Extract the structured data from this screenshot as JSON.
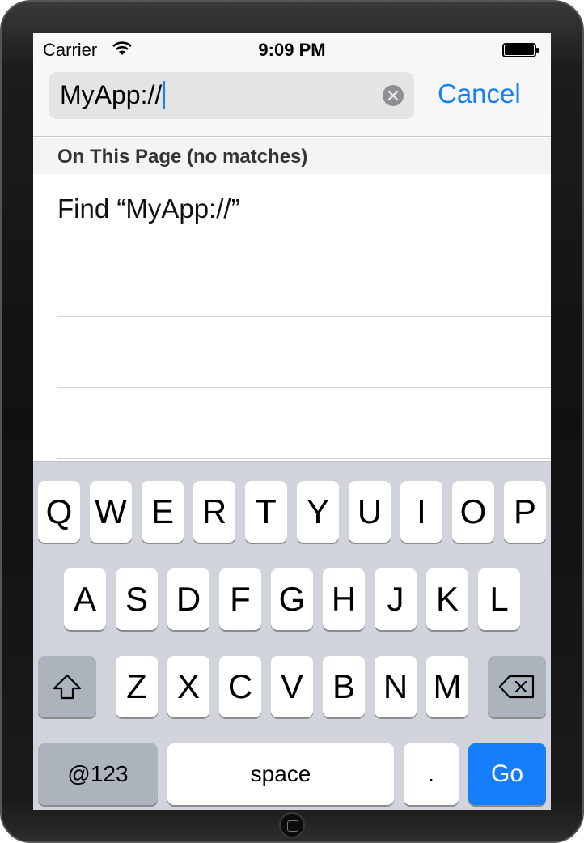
{
  "status_bar": {
    "carrier": "Carrier",
    "time": "9:09 PM",
    "wifi_icon": "wifi-icon",
    "battery_icon": "battery-icon"
  },
  "search": {
    "value": "MyApp://",
    "clear_icon": "clear-icon",
    "cancel_label": "Cancel"
  },
  "results": {
    "section_header": "On This Page (no matches)",
    "items": [
      "Find “MyApp://”",
      "",
      "",
      ""
    ]
  },
  "keyboard": {
    "row1": [
      "Q",
      "W",
      "E",
      "R",
      "T",
      "Y",
      "U",
      "I",
      "O",
      "P"
    ],
    "row2": [
      "A",
      "S",
      "D",
      "F",
      "G",
      "H",
      "J",
      "K",
      "L"
    ],
    "row3": [
      "Z",
      "X",
      "C",
      "V",
      "B",
      "N",
      "M"
    ],
    "shift_icon": "shift-icon",
    "delete_icon": "delete-icon",
    "numbers_label": "@123",
    "space_label": "space",
    "period_label": ".",
    "go_label": "Go"
  },
  "colors": {
    "accent": "#157efb",
    "go_key": "#147efb",
    "keyboard_bg": "#d1d5db"
  }
}
